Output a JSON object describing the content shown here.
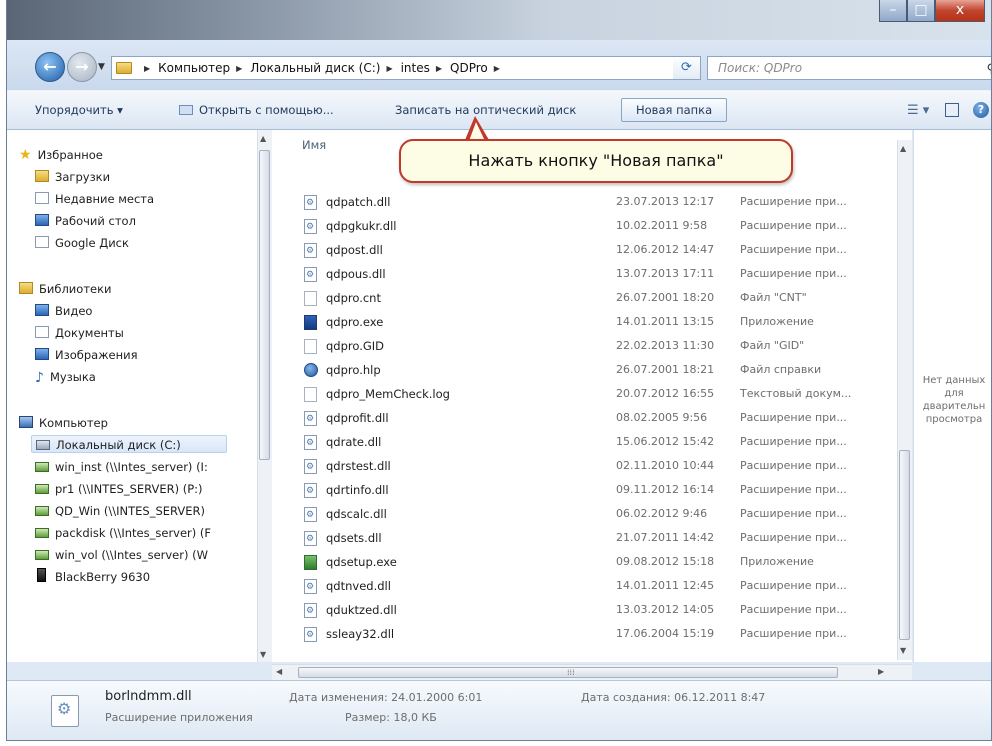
{
  "window": {
    "caption_buttons": {
      "minimize": "–",
      "maximize": "□",
      "close": "x"
    }
  },
  "address": {
    "crumbs": [
      "Компьютер",
      "Локальный диск (C:)",
      "intes",
      "QDPro"
    ],
    "search_placeholder": "Поиск: QDPro"
  },
  "toolbar": {
    "organize": "Упорядочить ▾",
    "open_with": "Открыть с помощью...",
    "burn": "Записать на оптический диск",
    "new_folder": "Новая папка"
  },
  "nav": {
    "favorites": "Избранное",
    "downloads": "Загрузки",
    "recent": "Недавние места",
    "desktop": "Рабочий стол",
    "google": "Google Диск",
    "libraries": "Библиотеки",
    "video": "Видео",
    "documents": "Документы",
    "pictures": "Изображения",
    "music": "Музыка",
    "computer": "Компьютер",
    "local_disk": "Локальный диск (C:)",
    "win_inst": "win_inst (\\\\Intes_server) (I:",
    "pr1": "pr1 (\\\\INTES_SERVER) (P:)",
    "qd_win": "QD_Win (\\\\INTES_SERVER)",
    "packdisk": "packdisk (\\\\Intes_server) (F",
    "win_vol": "win_vol (\\\\Intes_server) (W",
    "blackberry": "BlackBerry 9630"
  },
  "columns": {
    "name": "Имя"
  },
  "files": [
    {
      "name": "qdpatch.dll",
      "date": "23.07.2013 12:17",
      "type": "Расширение при...",
      "icon": "dll"
    },
    {
      "name": "qdpgkukr.dll",
      "date": "10.02.2011 9:58",
      "type": "Расширение при...",
      "icon": "dll"
    },
    {
      "name": "qdpost.dll",
      "date": "12.06.2012 14:47",
      "type": "Расширение при...",
      "icon": "dll"
    },
    {
      "name": "qdpous.dll",
      "date": "13.07.2013 17:11",
      "type": "Расширение при...",
      "icon": "dll"
    },
    {
      "name": "qdpro.cnt",
      "date": "26.07.2001 18:20",
      "type": "Файл \"CNT\"",
      "icon": "plain"
    },
    {
      "name": "qdpro.exe",
      "date": "14.01.2011 13:15",
      "type": "Приложение",
      "icon": "exe"
    },
    {
      "name": "qdpro.GID",
      "date": "22.02.2013 11:30",
      "type": "Файл \"GID\"",
      "icon": "plain"
    },
    {
      "name": "qdpro.hlp",
      "date": "26.07.2001 18:21",
      "type": "Файл справки",
      "icon": "hlp"
    },
    {
      "name": "qdpro_MemCheck.log",
      "date": "20.07.2012 16:55",
      "type": "Текстовый докум...",
      "icon": "plain"
    },
    {
      "name": "qdprofit.dll",
      "date": "08.02.2005 9:56",
      "type": "Расширение при...",
      "icon": "dll"
    },
    {
      "name": "qdrate.dll",
      "date": "15.06.2012 15:42",
      "type": "Расширение при...",
      "icon": "dll"
    },
    {
      "name": "qdrstest.dll",
      "date": "02.11.2010 10:44",
      "type": "Расширение при...",
      "icon": "dll"
    },
    {
      "name": "qdrtinfo.dll",
      "date": "09.11.2012 16:14",
      "type": "Расширение при...",
      "icon": "dll"
    },
    {
      "name": "qdscalc.dll",
      "date": "06.02.2012 9:46",
      "type": "Расширение при...",
      "icon": "dll"
    },
    {
      "name": "qdsets.dll",
      "date": "21.07.2011 14:42",
      "type": "Расширение при...",
      "icon": "dll"
    },
    {
      "name": "qdsetup.exe",
      "date": "09.08.2012 15:18",
      "type": "Приложение",
      "icon": "setup"
    },
    {
      "name": "qdtnved.dll",
      "date": "14.01.2011 12:45",
      "type": "Расширение при...",
      "icon": "dll"
    },
    {
      "name": "qduktzed.dll",
      "date": "13.03.2012 14:05",
      "type": "Расширение при...",
      "icon": "dll"
    },
    {
      "name": "ssleay32.dll",
      "date": "17.06.2004 15:19",
      "type": "Расширение при...",
      "icon": "dll"
    }
  ],
  "preview": {
    "text": "Нет данных\nдля\nдварительн\nпросмотра"
  },
  "details": {
    "name": "borlndmm.dll",
    "type": "Расширение приложения",
    "modified_label": "Дата изменения: 24.01.2000 6:01",
    "created_label": "Дата создания: 06.12.2011 8:47",
    "size_label": "Размер: 18,0 КБ"
  },
  "callout": {
    "text": "Нажать кнопку \"Новая папка\""
  }
}
